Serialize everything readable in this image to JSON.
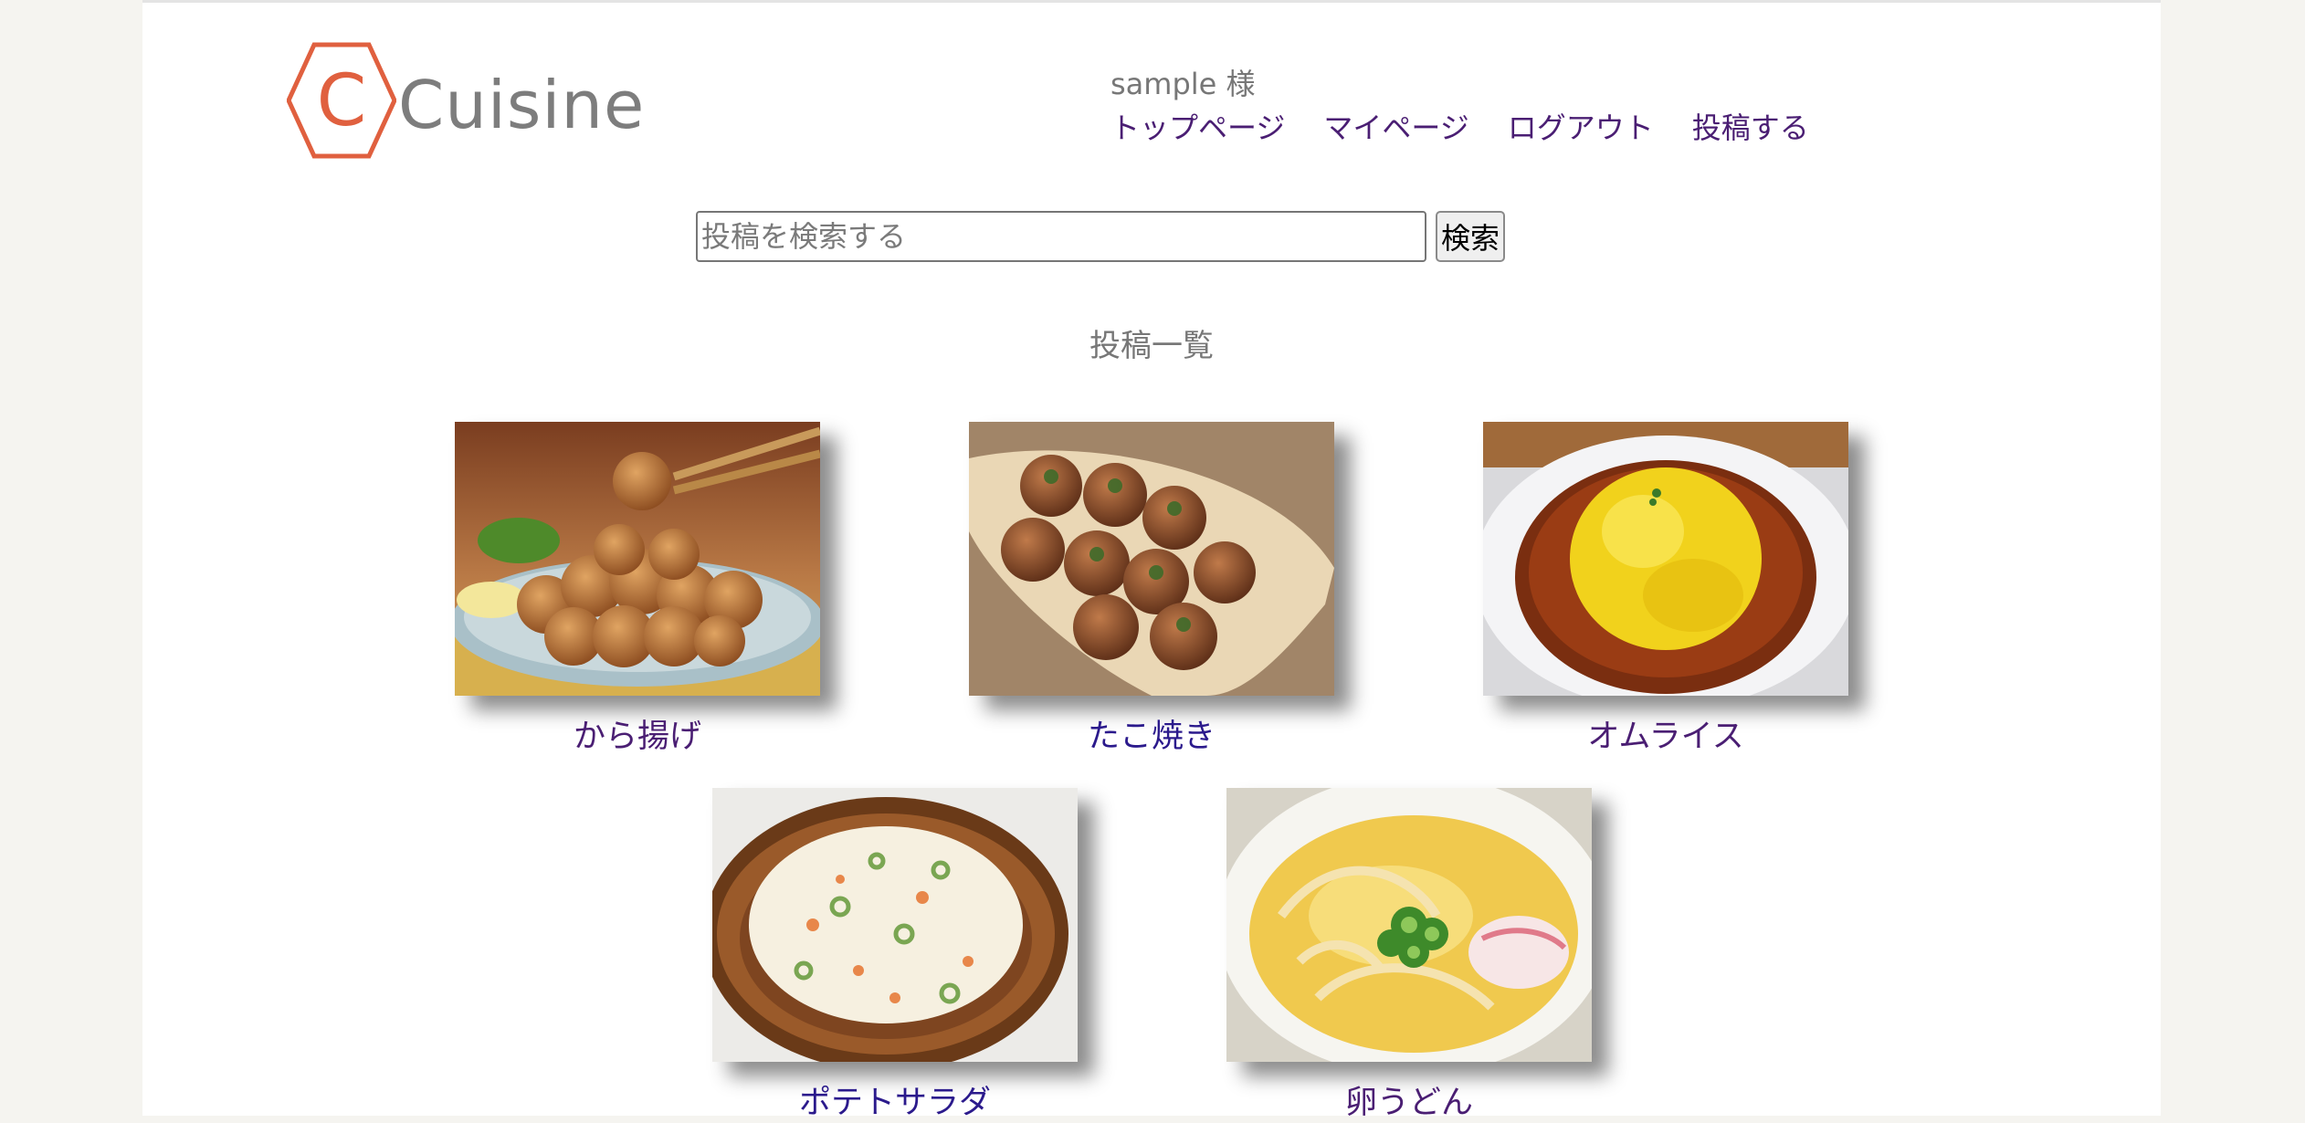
{
  "brand": {
    "logo_letter": "C",
    "name": "Cuisine",
    "logo_color": "#e0603f"
  },
  "header": {
    "user_label": "sample 様",
    "nav": [
      {
        "label": "トップページ"
      },
      {
        "label": "マイページ"
      },
      {
        "label": "ログアウト"
      },
      {
        "label": "投稿する"
      }
    ]
  },
  "search": {
    "placeholder": "投稿を検索する",
    "value": "",
    "button_label": "検索"
  },
  "main": {
    "section_title": "投稿一覧",
    "posts": [
      {
        "title": "から揚げ",
        "image": "karaage-photo"
      },
      {
        "title": "たこ焼き",
        "image": "takoyaki-photo"
      },
      {
        "title": "オムライス",
        "image": "omurice-photo"
      },
      {
        "title": "ポテトサラダ",
        "image": "potato-salad-photo"
      },
      {
        "title": "卵うどん",
        "image": "egg-udon-photo"
      }
    ]
  },
  "colors": {
    "link": "#2b1a8c",
    "visited_link": "#4a1e73",
    "muted_text": "#777777"
  }
}
